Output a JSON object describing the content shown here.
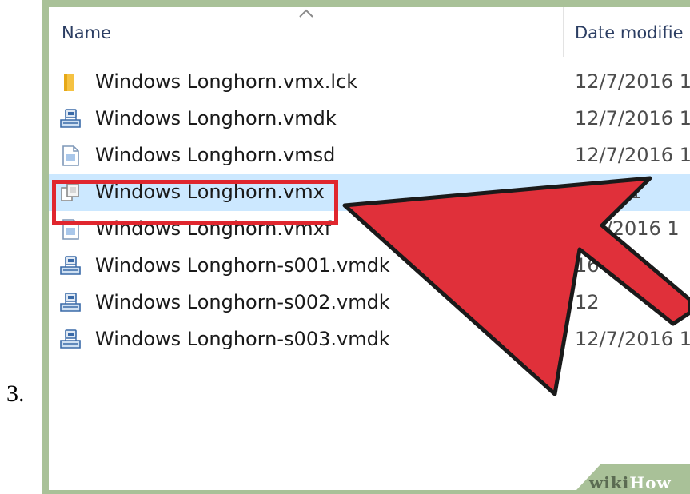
{
  "step": {
    "number": "3."
  },
  "columns": {
    "name": "Name",
    "date": "Date modifie"
  },
  "files": [
    {
      "name": "Windows Longhorn.vmx.lck",
      "date": "12/7/2016 1",
      "icon": "folder-icon"
    },
    {
      "name": "Windows Longhorn.vmdk",
      "date": "12/7/2016 1",
      "icon": "virtual-disk-icon"
    },
    {
      "name": "Windows Longhorn.vmsd",
      "date": "12/7/2016 1",
      "icon": "document-icon"
    },
    {
      "name": "Windows Longhorn.vmx",
      "date": "2016 1",
      "icon": "vmx-config-icon",
      "selected": true
    },
    {
      "name": "Windows Longhorn.vmxf",
      "date": "2/7/2016 1",
      "icon": "document-icon"
    },
    {
      "name": "Windows Longhorn-s001.vmdk",
      "date": "16 1",
      "icon": "virtual-disk-icon"
    },
    {
      "name": "Windows Longhorn-s002.vmdk",
      "date": "12",
      "icon": "virtual-disk-icon"
    },
    {
      "name": "Windows Longhorn-s003.vmdk",
      "date": "12/7/2016 1",
      "icon": "virtual-disk-icon"
    }
  ],
  "watermark": {
    "wiki": "wiki",
    "how": "How"
  },
  "colors": {
    "selection": "#cce8ff",
    "highlight_border": "#e0262e",
    "arrow_fill": "#e0303a",
    "frame_border": "#a9c198"
  }
}
